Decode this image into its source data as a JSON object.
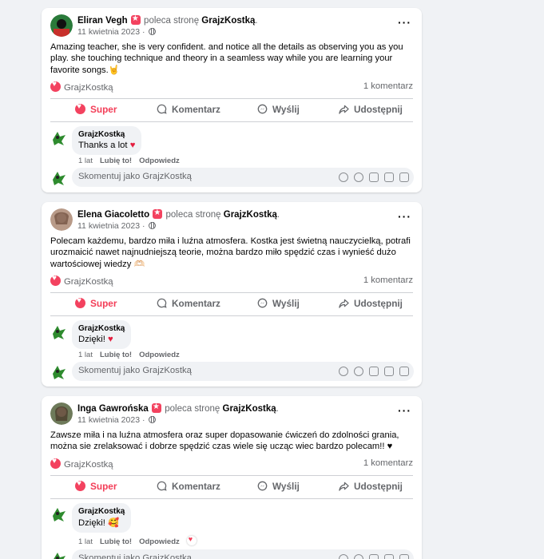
{
  "posts": [
    {
      "author": "Eliran Vegh",
      "recommends": "poleca stronę",
      "page": "GrajzKostką",
      "date": "11 kwietnia 2023 ·",
      "body": "Amazing teacher, she is very confident. and notice all the details as observing you as you play. she touching technique and theory in a seamless way while you are learning your favorite songs.🤘",
      "reaction_by": "GrajzKostką",
      "comment_count": "1 komentarz",
      "comment": {
        "name": "GrajzKostką",
        "text": "Thanks a lot",
        "emoji": "♥",
        "age": "1 lat"
      }
    },
    {
      "author": "Elena Giacoletto",
      "recommends": "poleca stronę",
      "page": "GrajzKostką",
      "date": "11 kwietnia 2023 ·",
      "body": "Polecam każdemu, bardzo miła i luźna atmosfera. Kostka jest świetną nauczycielką, potrafi urozmaicić nawet najnudniejszą teorie, można bardzo miło spędzić czas i wynieść dużo wartościowej wiedzy 🫶🏻",
      "reaction_by": "GrajzKostką",
      "comment_count": "1 komentarz",
      "comment": {
        "name": "GrajzKostką",
        "text": "Dzięki!",
        "emoji": "♥",
        "age": "1 lat"
      }
    },
    {
      "author": "Inga Gawrońska",
      "recommends": "poleca stronę",
      "page": "GrajzKostką",
      "date": "11 kwietnia 2023 ·",
      "body": "Zawsze miła i na luźna atmosfera oraz super dopasowanie ćwiczeń do zdolności grania, można sie zrelaksować i dobrze spędzić czas  wiele się ucząc wiec bardzo polecam!! ♥",
      "reaction_by": "GrajzKostką",
      "comment_count": "1 komentarz",
      "comment": {
        "name": "GrajzKostką",
        "text": "Dzięki!",
        "emoji": "🥰",
        "age": "1 lat"
      }
    }
  ],
  "actions": {
    "super": "Super",
    "comment": "Komentarz",
    "send": "Wyślij",
    "share": "Udostępnij"
  },
  "comment_links": {
    "like": "Lubię to!",
    "reply": "Odpowiedz"
  },
  "comment_placeholder": "Skomentuj jako GrajzKostką",
  "colors": {
    "accent_red": "#f33e58",
    "background": "#f0f2f5",
    "secondary_text": "#65676b"
  },
  "icons": [
    "more-options-icon",
    "globe-icon",
    "heart-reaction-icon",
    "super-heart-icon",
    "comment-icon",
    "messenger-icon",
    "share-icon",
    "avatar-sticker-icon",
    "emoji-icon",
    "camera-icon",
    "gif-icon",
    "sticker-icon"
  ]
}
